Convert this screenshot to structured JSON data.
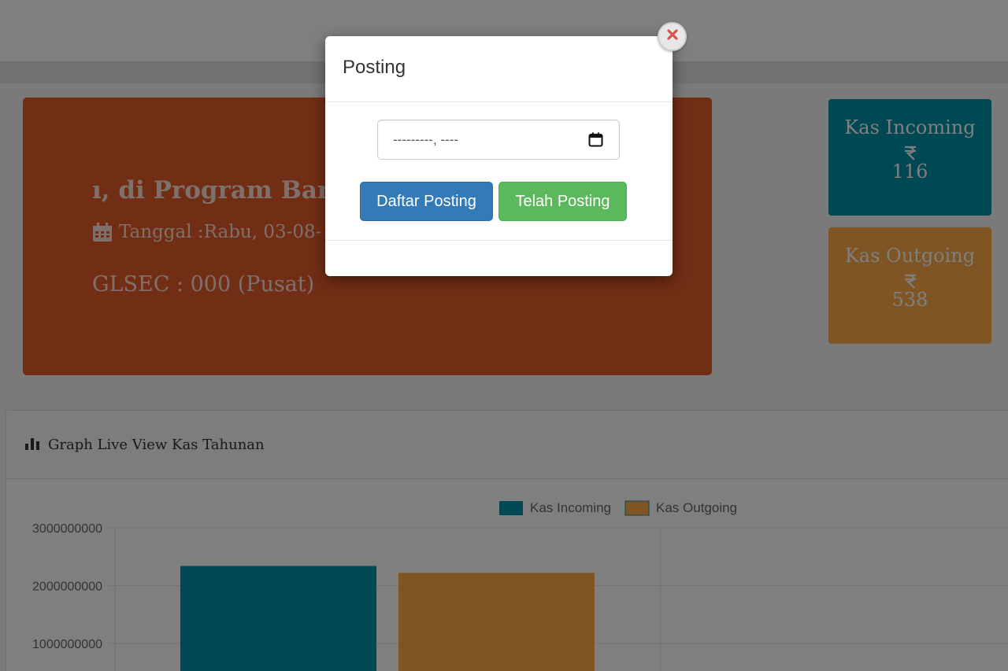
{
  "welcome": {
    "greeting": "ı, di Program Baru K",
    "date": "Tanggal :Rabu, 03-08-",
    "glsec": "GLSEC : 000 (Pusat)"
  },
  "stats": [
    {
      "title": "Kas Incoming",
      "value": "116",
      "icon": "rupiah-icon"
    },
    {
      "title": "Kas Outgoing",
      "value": "538",
      "icon": "rupiah-icon"
    }
  ],
  "panel": {
    "title": "Graph Live View Kas Tahunan",
    "icon": "bar-chart-icon"
  },
  "modal": {
    "title": "Posting",
    "date_placeholder": "---------, ----",
    "primary_button": "Daftar Posting",
    "success_button": "Telah Posting",
    "close_icon": "close-icon"
  },
  "colors": {
    "welcome_bg": "#e55a2b",
    "incoming": "#0090a9",
    "outgoing": "#ffaa48",
    "primary": "#337ab7",
    "success": "#5cb85c",
    "close_x": "#d9534f"
  },
  "chart_data": {
    "type": "bar",
    "categories": [
      ""
    ],
    "series": [
      {
        "name": "Kas Incoming",
        "values": [
          2340000000
        ]
      },
      {
        "name": "Kas Outgoing",
        "values": [
          2220000000
        ]
      }
    ],
    "yticks": [
      "1000000000",
      "2000000000",
      "3000000000"
    ],
    "ylim": [
      0,
      3000000000
    ],
    "legend": "top-center",
    "grid": true
  }
}
